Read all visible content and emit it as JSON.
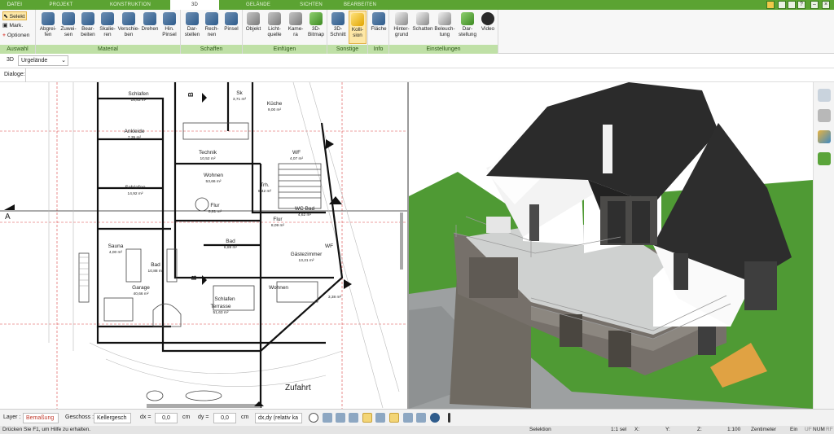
{
  "tabs": [
    "DATEI",
    "PROJEKT",
    "KONSTRUKTION",
    "3D",
    "GELÄNDE",
    "SICHTEN",
    "BEARBEITEN"
  ],
  "ribbon": {
    "auswahl": {
      "label": "Auswahl",
      "items": [
        "Selekt",
        "Mark.",
        "Optionen"
      ]
    },
    "material": {
      "label": "Material",
      "buttons": [
        [
          "Abgrei-",
          "fen"
        ],
        [
          "Zuwei-",
          "sen"
        ],
        [
          "Bear-",
          "beiten"
        ],
        [
          "Skalie-",
          "ren"
        ],
        [
          "Verschie-",
          "ben"
        ],
        [
          "Drehen",
          ""
        ],
        [
          "Hin.",
          "Pinsel"
        ]
      ]
    },
    "schaffen": {
      "label": "Schaffen",
      "buttons": [
        [
          "Dar-",
          "stellen"
        ],
        [
          "Rech-",
          "nen"
        ],
        [
          "Pinsel",
          ""
        ]
      ]
    },
    "einfuegen": {
      "label": "Einfügen",
      "buttons": [
        [
          "Objekt",
          ""
        ],
        [
          "Licht-",
          "quelle"
        ],
        [
          "Kame-",
          "ra"
        ],
        [
          "3D-",
          "Bitmap"
        ]
      ]
    },
    "sonstige": {
      "label": "Sonstige",
      "buttons": [
        [
          "3D-",
          "Schnitt"
        ],
        [
          "Kolli-",
          "sion"
        ]
      ]
    },
    "info": {
      "label": "Info",
      "buttons": [
        [
          "Fläche",
          ""
        ]
      ]
    },
    "einstellungen": {
      "label": "Einstellungen",
      "buttons": [
        [
          "Hinter-",
          "grund"
        ],
        [
          "Schatten",
          ""
        ],
        [
          "Beleuch-",
          "tung"
        ],
        [
          "Dar-",
          "stellung"
        ],
        [
          "Video",
          ""
        ]
      ]
    }
  },
  "context": {
    "mode": "3D",
    "terrain": "Urgelände"
  },
  "dialoge_label": "Dialoge:",
  "plan": {
    "rooms": [
      {
        "name": "Schlafen",
        "area": "16,83 m²"
      },
      {
        "name": "Sk",
        "area": "3,71 m²"
      },
      {
        "name": "Küche",
        "area": "9,00 m²"
      },
      {
        "name": "Ankleide",
        "area": "7,35 m²"
      },
      {
        "name": "Technik",
        "area": "10,52 m²"
      },
      {
        "name": "WF",
        "area": "4,07 m²"
      },
      {
        "name": "Wohnen",
        "area": "53,66 m²"
      },
      {
        "name": "Schlafen",
        "area": "14,92 m²"
      },
      {
        "name": "Trh.",
        "area": "6,42 m²"
      },
      {
        "name": "Flur",
        "area": "8,81 m²"
      },
      {
        "name": "Flur",
        "area": "8,09 m²"
      },
      {
        "name": "WC Bad",
        "area": "4,62 m²"
      },
      {
        "name": "Bad",
        "area": "6,89 m²"
      },
      {
        "name": "Sauna",
        "area": "4,00 m²"
      },
      {
        "name": "WF",
        "area": ""
      },
      {
        "name": "Bad",
        "area": "10,88 m²"
      },
      {
        "name": "Gästezimmer",
        "area": "13,21 m²"
      },
      {
        "name": "Garage",
        "area": "40,66 m²"
      },
      {
        "name": "Wohnen",
        "area": ""
      },
      {
        "name": "Schlafen",
        "area": ""
      },
      {
        "name": "Terrasse",
        "area": "51,63 m²"
      },
      {
        "name": "",
        "area": "3,38 m²"
      }
    ],
    "section_labels": [
      "A",
      "B",
      "B"
    ],
    "road_label": "Zufahrt"
  },
  "options": {
    "layer_label": "Layer :",
    "layer_value": "Bemaßung",
    "geschoss_label": "Geschoss :",
    "geschoss_value": "Kellergesch",
    "dx_label": "dx =",
    "dx_value": "0,0",
    "dy_label": "dy =",
    "dy_value": "0,0",
    "unit": "cm",
    "mode_value": "dx,dy (relativ ka"
  },
  "status": {
    "hint": "Drücken Sie F1, um Hilfe zu erhalten.",
    "selection": "Selektion",
    "scale": "1:1 sel",
    "x": "X:",
    "y": "Y:",
    "z": "Z:",
    "ratio": "1:100",
    "unit": "Zentimeter",
    "lang": "Ein",
    "uf": "UF",
    "num": "NUM",
    "rf": "RF"
  },
  "colors": {
    "brand_green": "#5ba332",
    "ribbon_group": "#bfe0a6",
    "grass": "#4f9a34",
    "roof": "#2b2b2b"
  }
}
